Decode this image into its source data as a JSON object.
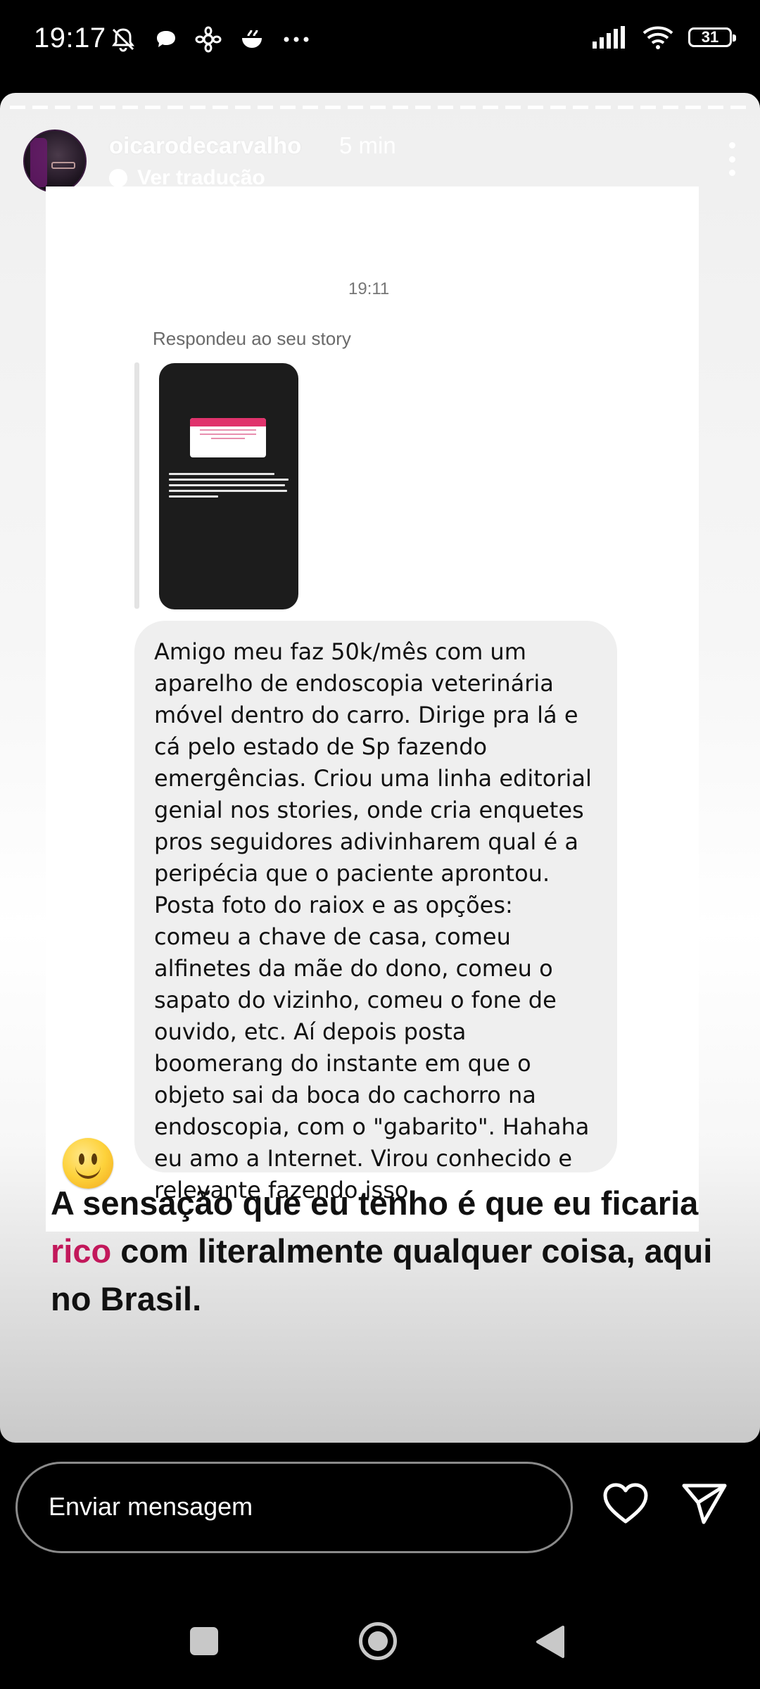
{
  "status_bar": {
    "time": "19:17",
    "battery": "31",
    "left_icons": [
      "bell-off-icon",
      "chat-bubble-icon",
      "flower-icon",
      "bowl-icon",
      "more-dots-icon"
    ],
    "right_icons": [
      "signal-icon",
      "wifi-icon",
      "battery-icon"
    ]
  },
  "story": {
    "username": "oicarodecarvalho",
    "time_ago": "5 min",
    "translate_label": "Ver tradução",
    "dm": {
      "timestamp": "19:11",
      "replied_label": "Respondeu ao seu story",
      "message": "Amigo meu faz 50k/mês com um\naparelho de endoscopia veterinária\nmóvel dentro do carro. Dirige pra lá e\ncá pelo estado de Sp fazendo\nemergências. Criou uma linha editorial\ngenial nos stories, onde cria enquetes\npros seguidores adivinharem qual é a\nperipécia que o paciente aprontou.\nPosta foto do raiox e as opções:\ncomeu a chave de casa, comeu\nalfinetes da mãe do dono, comeu o\nsapato do vizinho, comeu o fone de\nouvido, etc. Aí depois posta\nboomerang do instante em que o\nobjeto sai da boca do cachorro na\nendoscopia, com o \"gabarito\". Hahaha\neu amo a Internet. Virou conhecido e\nrelevante fazendo isso"
    },
    "caption": {
      "before": "A sensação que eu tenho é que eu ficaria ",
      "highlight": "rico",
      "after": " com literalmente qualquer coisa, aqui no Brasil."
    },
    "highlight_color": "#c2185b"
  },
  "reply_bar": {
    "placeholder": "Enviar mensagem"
  }
}
